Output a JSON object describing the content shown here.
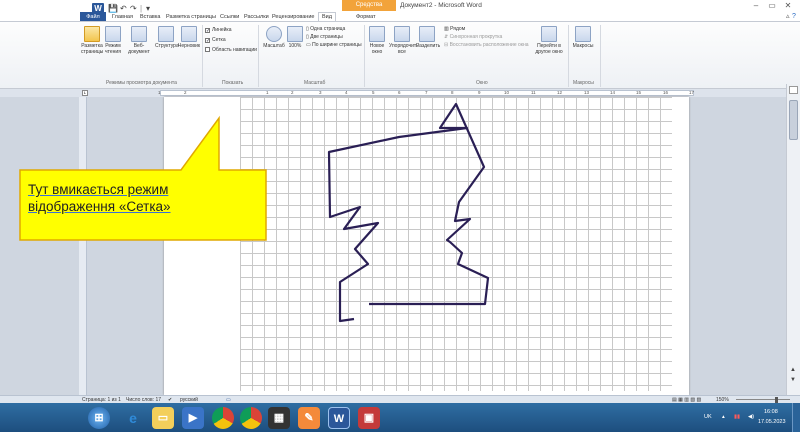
{
  "titlebar": {
    "quick_access": [
      "W",
      "↶",
      "↷",
      "|",
      "▾"
    ],
    "context_tab_header": "Средства рисования",
    "document_title": "Документ2 - Microsoft Word",
    "window_buttons": [
      "–",
      "▭",
      "✕"
    ]
  },
  "tabs": {
    "file": "Файл",
    "items": [
      "Главная",
      "Вставка",
      "Разметка страницы",
      "Ссылки",
      "Рассылки",
      "Рецензирование",
      "Вид",
      "Формат"
    ]
  },
  "ribbon": {
    "views": {
      "buttons": [
        "Разметка страницы",
        "Режим чтения",
        "Веб-документ",
        "Структура",
        "Черновик"
      ],
      "group_label": "Режимы просмотра документа"
    },
    "show": {
      "items": [
        {
          "label": "Линейка",
          "checked": true
        },
        {
          "label": "Сетка",
          "checked": true
        },
        {
          "label": "Область навигации",
          "checked": false
        }
      ],
      "group_label": "Показать"
    },
    "zoom": {
      "buttons": [
        "Масштаб",
        "100%"
      ],
      "small": [
        "Одна страница",
        "Две страницы",
        "По ширине страницы"
      ],
      "group_label": "Масштаб"
    },
    "window": {
      "buttons": [
        "Новое окно",
        "Упорядочить все",
        "Разделить"
      ],
      "small": [
        "Рядом",
        "Синхронная прокрутка",
        "Восстановить расположение окна"
      ],
      "switch_button": "Перейти в другое окно",
      "group_label": "Окно"
    },
    "macros": {
      "button": "Макросы",
      "group_label": "Макросы"
    }
  },
  "ruler": {
    "marks": [
      "1",
      "2",
      "1",
      "2",
      "3",
      "4",
      "5",
      "6",
      "7",
      "8",
      "9",
      "10",
      "11",
      "12",
      "13",
      "14",
      "15",
      "16",
      "17"
    ]
  },
  "callout": {
    "line1": "Тут вмикається  режим",
    "line2": "відображення «Сетка»",
    "fill": "#ffff00",
    "stroke": "#e0a800"
  },
  "drawing": {
    "stroke": "#2a1f55"
  },
  "statusbar": {
    "page": "Страница: 1 из 1",
    "words": "Число слов: 17",
    "language": "русский",
    "zoom": "150%"
  },
  "taskbar": {
    "apps": [
      "start",
      "ie",
      "explorer",
      "media",
      "chrome",
      "chrome2",
      "video",
      "paint",
      "word",
      "pictures"
    ],
    "tray_lang": "UK",
    "time": "16:08",
    "date": "17.05.2023"
  }
}
